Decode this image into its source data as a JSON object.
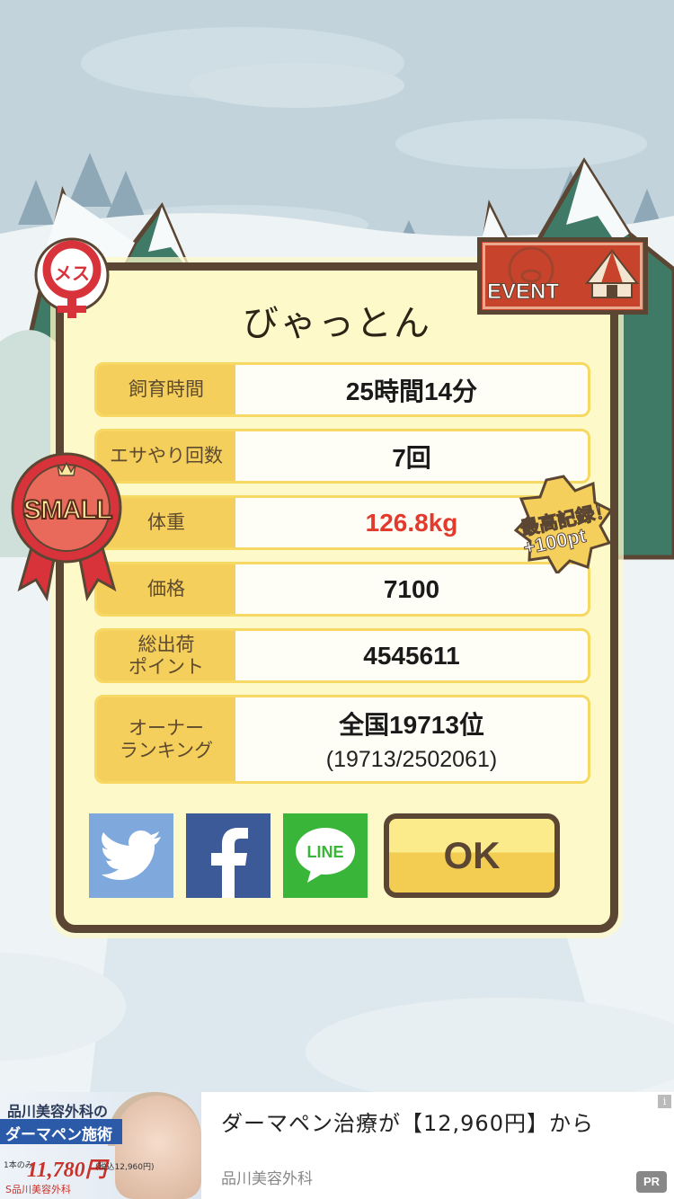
{
  "dialog": {
    "title": "びゃっとん",
    "rows": [
      {
        "label": "飼育時間",
        "value": "25時間14分"
      },
      {
        "label": "エサやり回数",
        "value": "7回"
      },
      {
        "label": "体重",
        "value": "126.8kg"
      },
      {
        "label": "価格",
        "value": "7100"
      },
      {
        "label": "総出荷\nポイント",
        "value": "4545611"
      },
      {
        "label": "オーナー\nランキング",
        "value": "全国19713位",
        "sub": "(19713/2502061)"
      }
    ],
    "share": {
      "twitter_icon": "twitter-bird-icon",
      "facebook_icon": "facebook-f-icon",
      "line_label": "LINE"
    },
    "ok_label": "OK"
  },
  "badges": {
    "gender_text": "メス",
    "event_text": "EVENT",
    "size_text": "SMALL",
    "record_line1": "最高記録！",
    "record_line2": "+100pt"
  },
  "ad": {
    "image_line1": "品川美容外科の",
    "image_line2": "ダーマペン施術",
    "image_price_prefix": "1本のみ",
    "image_price": "11,780円",
    "image_price_note": "(税込12,960円)",
    "image_foot": "S品川美容外科",
    "headline": "ダーマペン治療が【12,960円】から",
    "advertiser": "品川美容外科",
    "info_icon": "i",
    "pr_label": "PR"
  },
  "colors": {
    "frame": "#5b4634",
    "panel": "#fdf9c8",
    "label_bg": "#f5cf5c",
    "weight_red": "#e23a2d",
    "twitter": "#7fa9dd",
    "facebook": "#3d5a98",
    "line": "#39b53a"
  }
}
